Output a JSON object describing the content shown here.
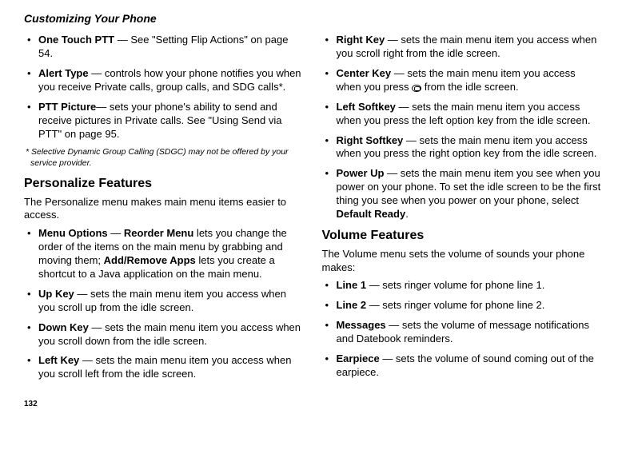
{
  "header": "Customizing Your Phone",
  "page_number": "132",
  "left": {
    "items": [
      {
        "bold": "One Touch PTT",
        "rest": " — See \"Setting Flip Actions\" on page 54."
      },
      {
        "bold": "Alert Type",
        "rest": " — controls how your phone notifies you when you receive Private calls, group calls, and SDG calls*."
      },
      {
        "bold": "PTT Picture",
        "rest": "— sets your phone's ability to send and receive pictures in Private calls. See \"Using Send via PTT\" on page 95."
      }
    ],
    "footnote": "*  Selective Dynamic Group Calling (SDGC) may not be offered by your service provider.",
    "subhead": "Personalize Features",
    "intro": "The Personalize menu makes main menu items easier to access.",
    "items2": [
      {
        "html": "<span class='b'>Menu Options</span> — <span class='b'>Reorder Menu</span> lets you change the order of the items on the main menu by grabbing and moving them; <span class='b'>Add/Remove Apps</span> lets you create a shortcut to a Java application on the main menu."
      },
      {
        "bold": "Up Key",
        "rest": " — sets the main menu item you access when you scroll up from the idle screen."
      },
      {
        "bold": "Down Key",
        "rest": " — sets the main menu item you access when you scroll down from the idle screen."
      },
      {
        "bold": "Left Key",
        "rest": " — sets the main menu item you access when you scroll left from the idle screen."
      }
    ]
  },
  "right": {
    "items": [
      {
        "bold": "Right Key",
        "rest": " — sets the main menu item you access when you scroll right from the idle screen."
      },
      {
        "html": "<span class='b'>Center Key</span> — sets the main menu item you access when you press <span class='okicon' data-name='ok-key-icon' data-interactable='false'></span> from the idle screen."
      },
      {
        "bold": "Left Softkey",
        "rest": " — sets the main menu item you access when you press the left option key from the idle screen."
      },
      {
        "bold": "Right Softkey",
        "rest": " — sets the main menu item you access when you press the right option key from the idle screen."
      },
      {
        "html": "<span class='b'>Power Up</span> — sets the main menu item you see when you power on your phone. To set the idle screen to be the first thing you see when you power on your phone, select <span class='b'>Default Ready</span>."
      }
    ],
    "subhead": "Volume Features",
    "intro": "The Volume menu sets the volume of sounds your phone makes:",
    "items2": [
      {
        "bold": "Line 1",
        "rest": " — sets ringer volume for phone line 1."
      },
      {
        "bold": "Line 2",
        "rest": " — sets ringer volume for phone line 2."
      },
      {
        "bold": "Messages",
        "rest": " — sets the volume of message notifications and Datebook reminders."
      },
      {
        "bold": "Earpiece",
        "rest": " — sets the volume of sound coming out of the earpiece."
      }
    ]
  }
}
